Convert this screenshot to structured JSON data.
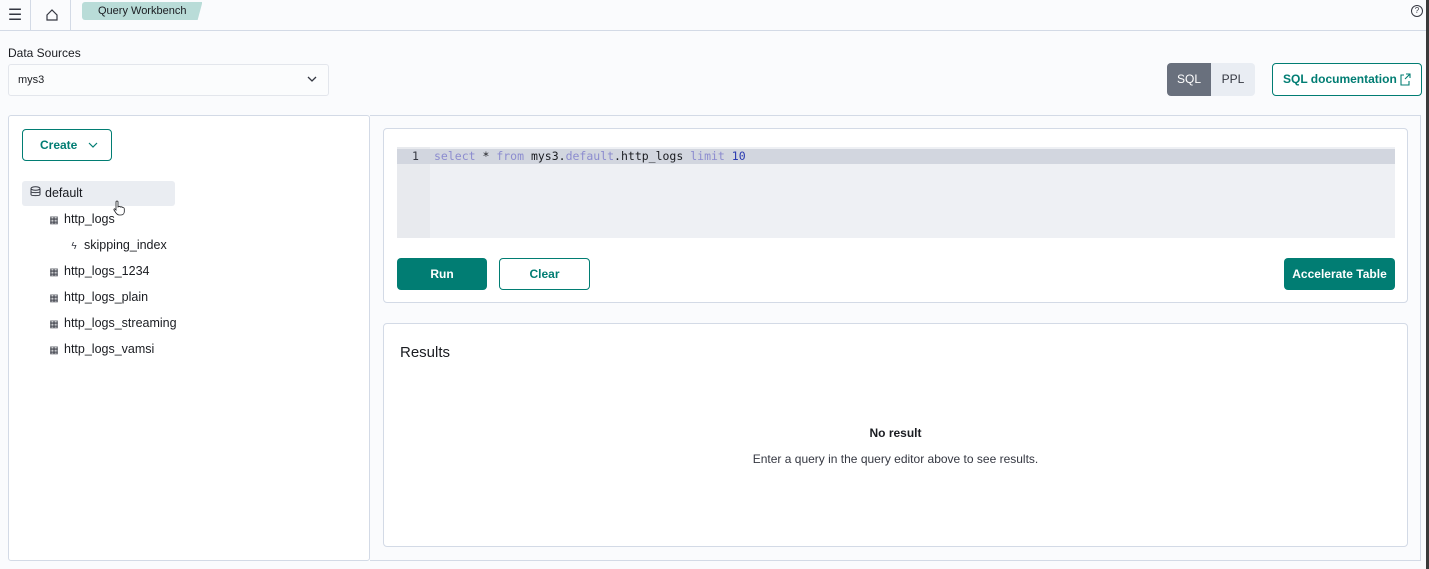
{
  "topbar": {
    "menu_icon": "hamburger-menu-icon",
    "home_icon": "home-icon",
    "breadcrumb": "Query Workbench",
    "help_icon": "help-icon",
    "help_glyph": "?"
  },
  "data_sources": {
    "label": "Data Sources",
    "selected": "mys3"
  },
  "language_toggle": {
    "options": [
      "SQL",
      "PPL"
    ],
    "selected": "SQL"
  },
  "documentation_link": "SQL documentation",
  "sidebar": {
    "create_label": "Create",
    "tree": [
      {
        "label": "default",
        "type": "database",
        "selected": true
      },
      {
        "label": "http_logs",
        "type": "table"
      },
      {
        "label": "skipping_index",
        "type": "index"
      },
      {
        "label": "http_logs_1234",
        "type": "table"
      },
      {
        "label": "http_logs_plain",
        "type": "table"
      },
      {
        "label": "http_logs_streaming",
        "type": "table"
      },
      {
        "label": "http_logs_vamsi",
        "type": "table"
      }
    ]
  },
  "editor": {
    "line_number": "1",
    "tokens": [
      {
        "text": "select",
        "kind": "kw"
      },
      {
        "text": " * ",
        "kind": "plain"
      },
      {
        "text": "from",
        "kind": "kw"
      },
      {
        "text": " mys3.",
        "kind": "plain"
      },
      {
        "text": "default",
        "kind": "kw"
      },
      {
        "text": ".http_logs ",
        "kind": "plain"
      },
      {
        "text": "limit",
        "kind": "kw"
      },
      {
        "text": " ",
        "kind": "plain"
      },
      {
        "text": "10",
        "kind": "num"
      }
    ]
  },
  "actions": {
    "run": "Run",
    "clear": "Clear",
    "accelerate": "Accelerate Table"
  },
  "results": {
    "title": "Results",
    "empty_title": "No result",
    "empty_hint": "Enter a query in the query editor above to see results."
  },
  "colors": {
    "primary": "#017d73",
    "breadcrumb_bg": "#b9dcd8",
    "toggle_selected": "#69707d"
  }
}
